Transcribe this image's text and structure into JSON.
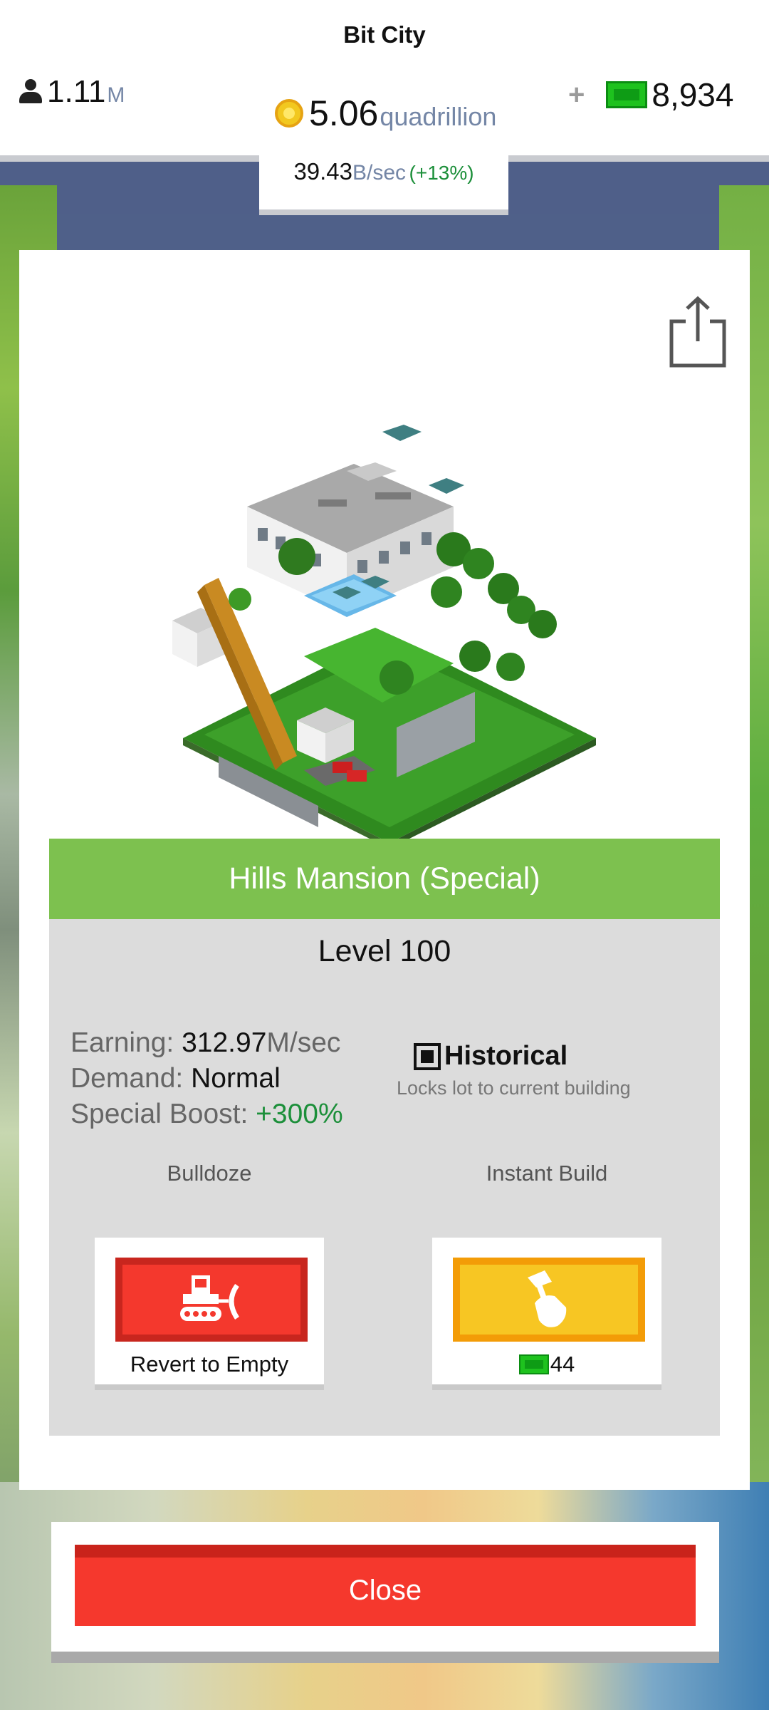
{
  "app": {
    "title": "Bit City"
  },
  "status": {
    "population_value": "1.11",
    "population_unit": "M",
    "coins_value": "5.06",
    "coins_unit": "quadrillion",
    "bux_plus": "+",
    "bux_value": "8,934",
    "rate_value": "39.43",
    "rate_unit": "B/sec",
    "rate_bonus": "(+13%)"
  },
  "building": {
    "name": "Hills Mansion (Special)",
    "level": "Level 100",
    "earning_label": "Earning:",
    "earning_value": "312.97",
    "earning_unit": "M/sec",
    "demand_label": "Demand:",
    "demand_value": "Normal",
    "boost_label": "Special Boost:",
    "boost_value": "+300%",
    "historical_title": "Historical",
    "historical_subtitle": "Locks lot to current building",
    "historical_checked": true
  },
  "actions": {
    "bulldoze_label": "Bulldoze",
    "bulldoze_caption": "Revert to Empty",
    "instant_label": "Instant Build",
    "instant_cost": "44"
  },
  "footer": {
    "close_label": "Close"
  },
  "colors": {
    "header_green": "#7dc14f",
    "bulldoze_red": "#f4382d",
    "instant_yellow": "#f7c623",
    "close_red": "#f5382d",
    "accent_blue_gray": "#7486a6",
    "bonus_green": "#1c8f3a"
  },
  "icons": {
    "population": "person-icon",
    "coins": "coin-icon",
    "bux": "bux-icon",
    "share": "share-icon",
    "bulldoze": "bulldozer-icon",
    "instant_build": "hammer-hand-icon"
  }
}
